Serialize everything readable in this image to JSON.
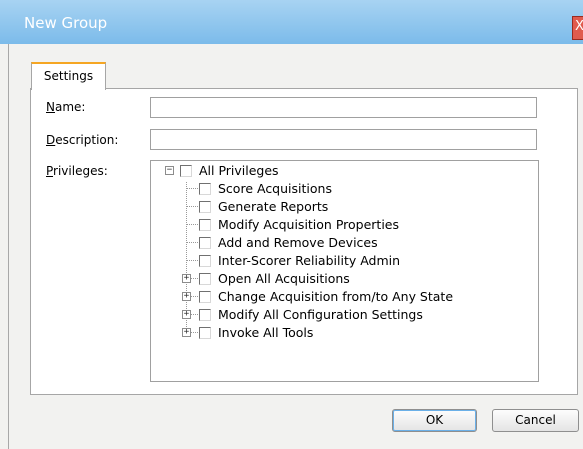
{
  "window": {
    "title": "New Group",
    "close_glyph": "X"
  },
  "tabs": [
    {
      "label": "Settings",
      "active": true
    }
  ],
  "form": {
    "name": {
      "mnemonic": "N",
      "rest": "ame:",
      "value": ""
    },
    "description": {
      "mnemonic": "D",
      "rest": "escription:",
      "value": ""
    },
    "privileges": {
      "mnemonic": "P",
      "rest": "rivileges:"
    }
  },
  "privileges_tree": {
    "root": {
      "label": "All Privileges",
      "expanded": true,
      "checked": false
    },
    "children": [
      {
        "label": "Score Acquisitions",
        "expandable": false,
        "checked": false
      },
      {
        "label": "Generate Reports",
        "expandable": false,
        "checked": false
      },
      {
        "label": "Modify Acquisition Properties",
        "expandable": false,
        "checked": false
      },
      {
        "label": "Add and Remove Devices",
        "expandable": false,
        "checked": false
      },
      {
        "label": "Inter-Scorer Reliability Admin",
        "expandable": false,
        "checked": false
      },
      {
        "label": "Open All Acquisitions",
        "expandable": true,
        "checked": false
      },
      {
        "label": "Change Acquisition from/to Any State",
        "expandable": true,
        "checked": false
      },
      {
        "label": "Modify All Configuration Settings",
        "expandable": true,
        "checked": false
      },
      {
        "label": "Invoke All Tools",
        "expandable": true,
        "checked": false
      }
    ]
  },
  "buttons": {
    "ok": "OK",
    "cancel": "Cancel"
  },
  "colors": {
    "title_bar": "#8cc4ee",
    "tab_accent": "#f5a623",
    "close_button": "#e05b4e"
  }
}
